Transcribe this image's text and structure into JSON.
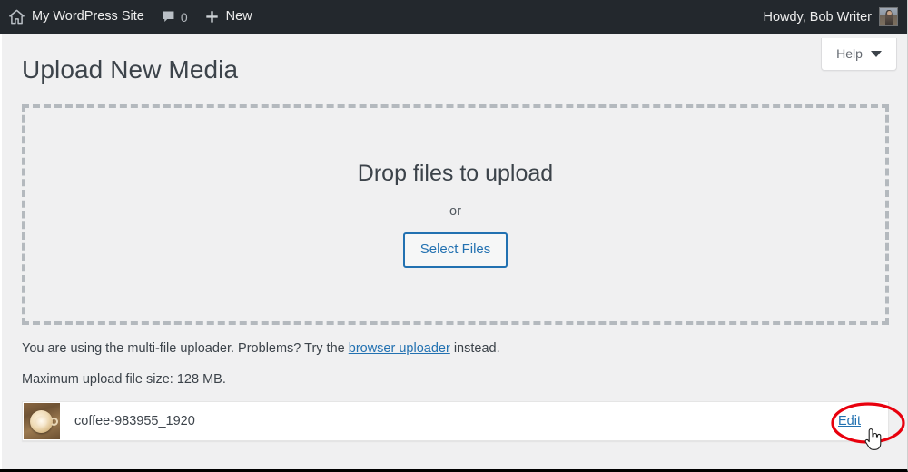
{
  "adminbar": {
    "site_name": "My WordPress Site",
    "home_icon": "home-icon",
    "comments_icon": "comment-bubble-icon",
    "comments_count": "0",
    "new_icon": "plus-icon",
    "new_label": "New",
    "howdy": "Howdy, Bob Writer",
    "avatar_icon": "user-avatar"
  },
  "help": {
    "label": "Help",
    "caret_icon": "chevron-down-icon"
  },
  "page": {
    "title": "Upload New Media"
  },
  "dropzone": {
    "title": "Drop files to upload",
    "or": "or",
    "select_files_label": "Select Files"
  },
  "notes": {
    "uploader_prefix": "You are using the multi-file uploader. Problems? Try the ",
    "uploader_link": "browser uploader",
    "uploader_suffix": " instead.",
    "max_size": "Maximum upload file size: 128 MB."
  },
  "media": {
    "thumbnail_icon": "coffee-cup-thumbnail",
    "filename": "coffee-983955_1920",
    "edit_label": "Edit"
  },
  "annotation": {
    "shape": "red-ellipse-highlight",
    "color": "#e8000d",
    "target": "edit-link"
  },
  "cursor": {
    "icon": "pointing-hand-cursor"
  },
  "colors": {
    "adminbar_bg": "#23282d",
    "page_bg": "#f0f0f1",
    "link_blue": "#2271b1",
    "text_dark": "#3c434a",
    "dashed_border": "#b4b9be",
    "annotation_red": "#e8000d"
  }
}
